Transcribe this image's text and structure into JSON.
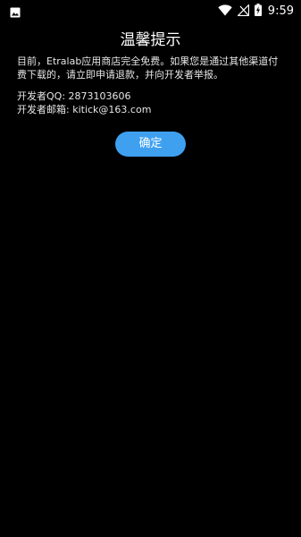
{
  "status_bar": {
    "time": "9:59",
    "icons": [
      "gallery-icon",
      "wifi-icon",
      "no-signal-icon",
      "battery-charging-icon"
    ]
  },
  "dialog": {
    "title": "温馨提示",
    "message_line1": "目前，Etralab应用商店完全免费。如果您是通过其他渠道付",
    "message_line2": "费下载的，请立即申请退款，并向开发者举报。",
    "qq_label": "开发者QQ:",
    "qq_value": "2873103606",
    "email_label": "开发者邮箱:",
    "email_value": "kitick@163.com",
    "confirm_label": "确定"
  },
  "colors": {
    "background": "#000000",
    "accent": "#3fa0f0",
    "text": "#ffffff"
  }
}
